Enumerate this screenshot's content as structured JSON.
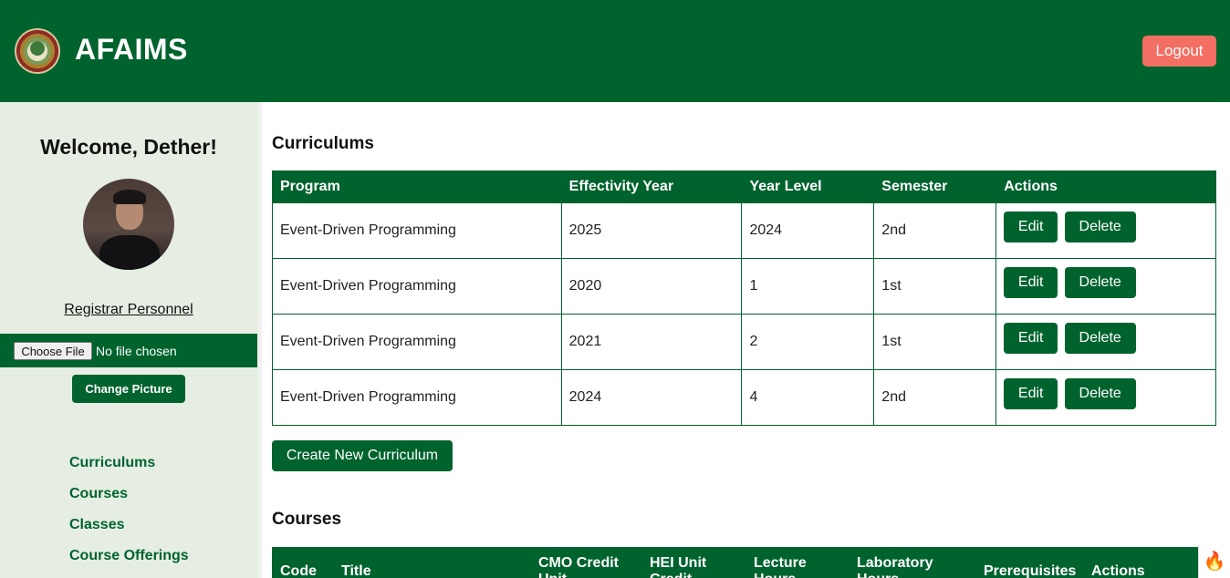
{
  "header": {
    "brand": "AFAIMS",
    "logout_label": "Logout"
  },
  "sidebar": {
    "welcome": "Welcome, Dether!",
    "role": "Registrar Personnel",
    "file_button": "Choose File",
    "file_status": "No file chosen",
    "change_picture": "Change Picture",
    "nav": [
      "Curriculums",
      "Courses",
      "Classes",
      "Course Offerings"
    ]
  },
  "curriculums": {
    "title": "Curriculums",
    "columns": [
      "Program",
      "Effectivity Year",
      "Year Level",
      "Semester",
      "Actions"
    ],
    "rows": [
      [
        "Event-Driven Programming",
        "2025",
        "2024",
        "2nd"
      ],
      [
        "Event-Driven Programming",
        "2020",
        "1",
        "1st"
      ],
      [
        "Event-Driven Programming",
        "2021",
        "2",
        "1st"
      ],
      [
        "Event-Driven Programming",
        "2024",
        "4",
        "2nd"
      ]
    ],
    "edit_label": "Edit",
    "delete_label": "Delete",
    "create_label": "Create New Curriculum"
  },
  "courses": {
    "title": "Courses",
    "columns": [
      "Code",
      "Title",
      "CMO Credit Unit",
      "HEI Unit Credit",
      "Lecture Hours",
      "Laboratory Hours",
      "Prerequisites",
      "Actions"
    ]
  },
  "colors": {
    "primary": "#00632e",
    "sidebar_bg": "#e6eee4",
    "logout": "#f36e63"
  },
  "icons": {
    "logo": "institution-seal-icon",
    "corner": "flame-icon"
  }
}
